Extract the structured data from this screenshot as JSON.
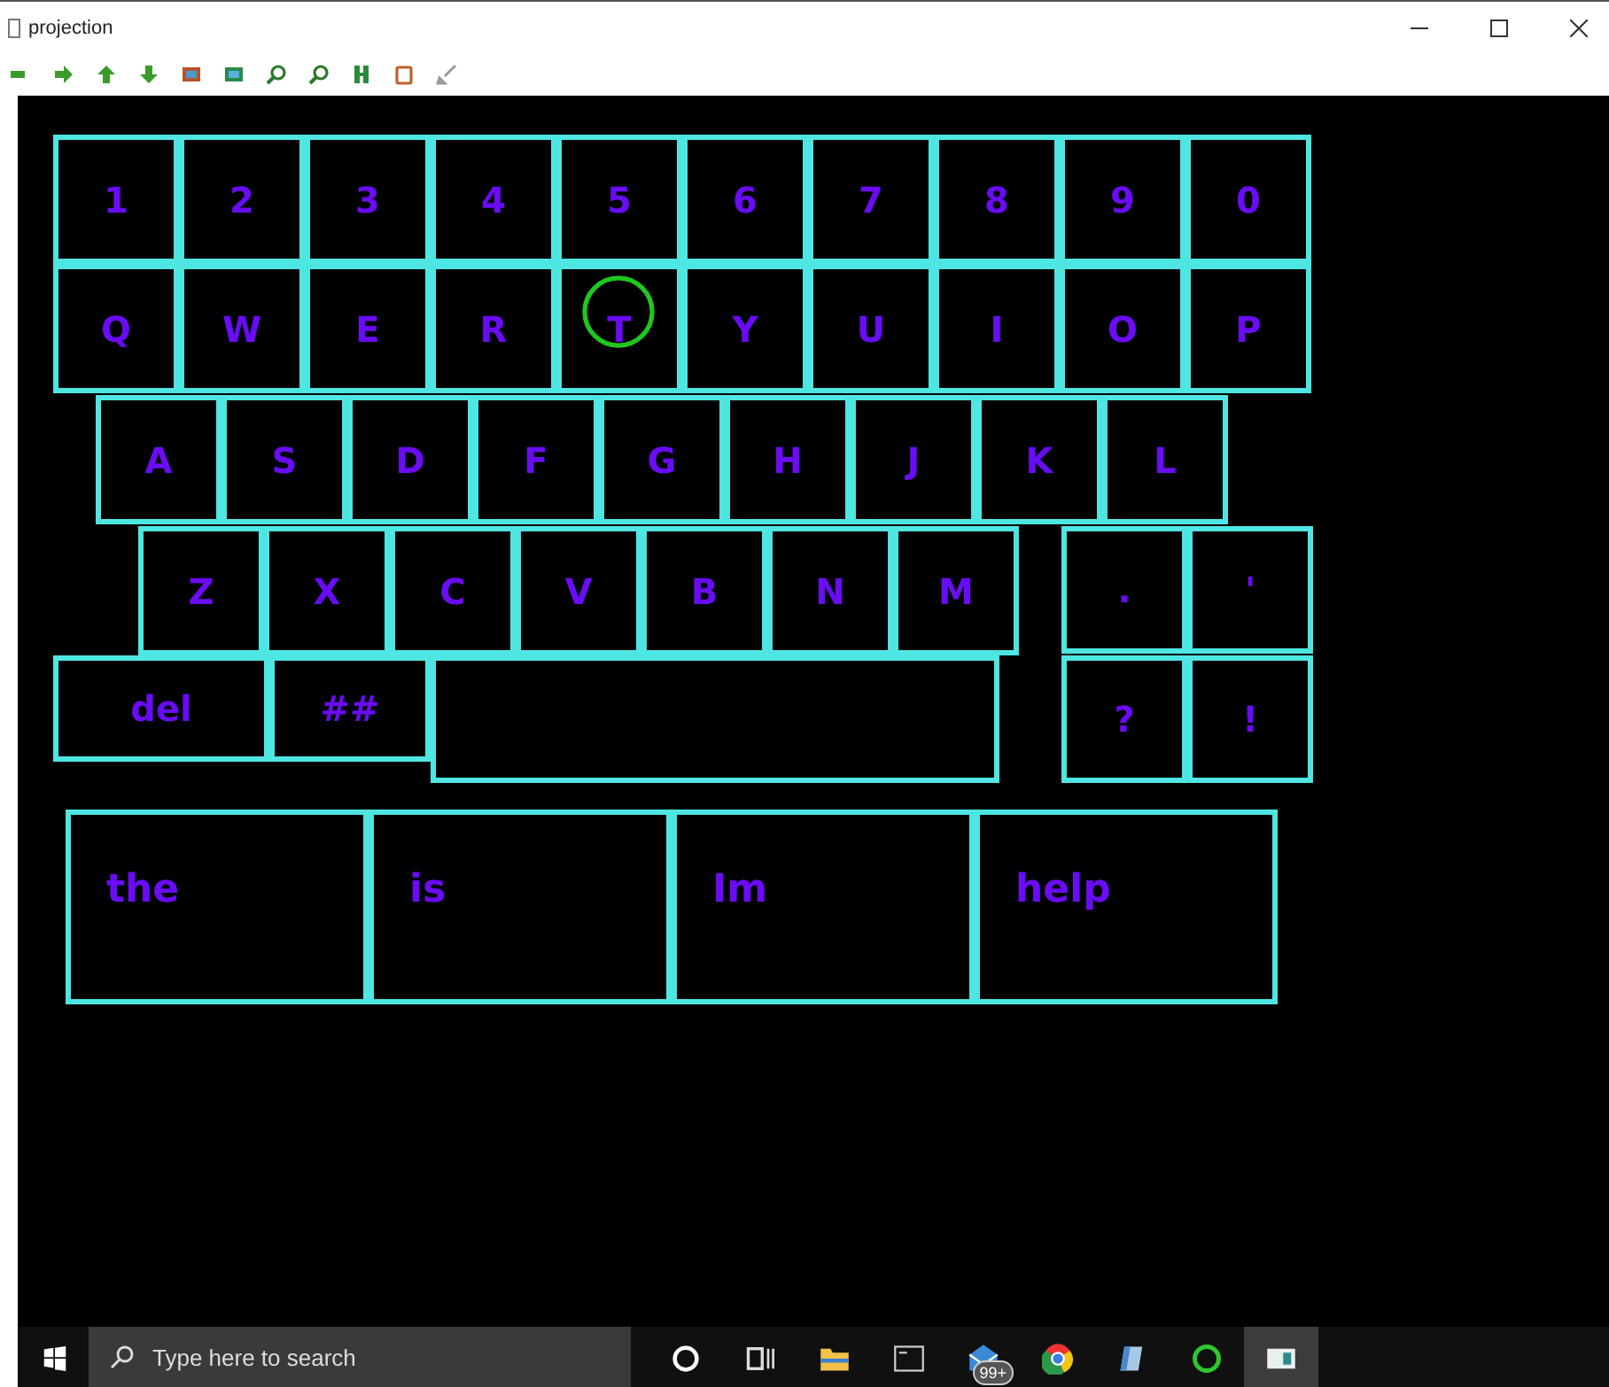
{
  "window": {
    "title": "projection"
  },
  "keyboard": {
    "rows": [
      {
        "keys": [
          "1",
          "2",
          "3",
          "4",
          "5",
          "6",
          "7",
          "8",
          "9",
          "0"
        ]
      },
      {
        "keys": [
          "Q",
          "W",
          "E",
          "R",
          "T",
          "Y",
          "U",
          "I",
          "O",
          "P"
        ]
      },
      {
        "keys": [
          "A",
          "S",
          "D",
          "F",
          "G",
          "H",
          "J",
          "K",
          "L"
        ]
      },
      {
        "keys": [
          "Z",
          "X",
          "C",
          "V",
          "B",
          "N",
          "M"
        ]
      }
    ],
    "punctuation": [
      ".",
      "'",
      "?",
      "!"
    ],
    "bottom": [
      "del",
      "##"
    ],
    "words": [
      "the",
      "is",
      "Im",
      "help"
    ]
  },
  "taskbar": {
    "search": {
      "placeholder": "Type here to search"
    },
    "mail_badge": "99+"
  }
}
